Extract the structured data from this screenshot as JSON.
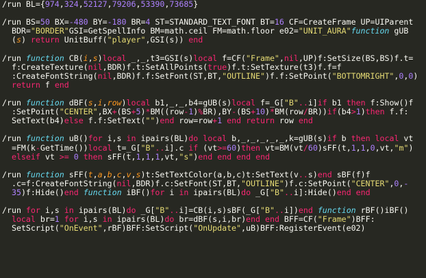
{
  "colors": {
    "background": "#272822",
    "default": "#F8F8F2",
    "keyword": "#F92672",
    "function_keyword": "#66D9EF",
    "string": "#E6DB74",
    "number": "#AE81FF",
    "parameter": "#FD971F"
  },
  "lines": [
    [
      [
        "id",
        "/run BL={"
      ],
      [
        "num",
        "974"
      ],
      [
        "id",
        ","
      ],
      [
        "num",
        "324"
      ],
      [
        "id",
        ","
      ],
      [
        "num",
        "52127"
      ],
      [
        "id",
        ","
      ],
      [
        "num",
        "79206"
      ],
      [
        "id",
        ","
      ],
      [
        "num",
        "53390"
      ],
      [
        "id",
        ","
      ],
      [
        "num",
        "73685"
      ],
      [
        "id",
        "}"
      ]
    ],
    [],
    [
      [
        "id",
        "/run BS="
      ],
      [
        "num",
        "50"
      ],
      [
        "id",
        " BX="
      ],
      [
        "num",
        "-480"
      ],
      [
        "id",
        " BY="
      ],
      [
        "num",
        "-180"
      ],
      [
        "id",
        " BR="
      ],
      [
        "num",
        "4"
      ],
      [
        "id",
        " ST=STANDARD_TEXT_FONT BT="
      ],
      [
        "num",
        "16"
      ],
      [
        "id",
        " CF=CreateFrame UP=UIParent"
      ]
    ],
    [
      [
        "id",
        "  BDR="
      ],
      [
        "str",
        "\"BORDER\""
      ],
      [
        "id",
        "GSI=GetSpellInfo BM=math.ceil FM=math.floor e02="
      ],
      [
        "str",
        "\"UNIT_AURA\""
      ],
      [
        "fn",
        "function"
      ],
      [
        "id",
        " gUB"
      ]
    ],
    [
      [
        "id",
        "  ("
      ],
      [
        "arg",
        "s"
      ],
      [
        "id",
        ") "
      ],
      [
        "kw",
        "return"
      ],
      [
        "id",
        " UnitBuff("
      ],
      [
        "str",
        "\"player\""
      ],
      [
        "id",
        ",GSI(s)) "
      ],
      [
        "kw",
        "end"
      ]
    ],
    [],
    [
      [
        "id",
        "/run "
      ],
      [
        "fn",
        "function"
      ],
      [
        "id",
        " CB("
      ],
      [
        "arg",
        "i"
      ],
      [
        "id",
        ","
      ],
      [
        "arg",
        "s"
      ],
      [
        "id",
        ")"
      ],
      [
        "kw",
        "local"
      ],
      [
        "id",
        " _,_,t3=GSI(s)"
      ],
      [
        "kw",
        "local"
      ],
      [
        "id",
        " f=CF("
      ],
      [
        "str",
        "\"Frame\""
      ],
      [
        "id",
        ","
      ],
      [
        "kw",
        "nil"
      ],
      [
        "id",
        ",UP)f:SetSize(BS,BS)f.t="
      ]
    ],
    [
      [
        "id",
        "  f:CreateTexture("
      ],
      [
        "kw",
        "nil"
      ],
      [
        "id",
        ",BDR)f.t:SetAllPoints("
      ],
      [
        "kw",
        "true"
      ],
      [
        "id",
        ")f.t:SetTexture(t3)f.f=f"
      ]
    ],
    [
      [
        "id",
        "  :CreateFontString("
      ],
      [
        "kw",
        "nil"
      ],
      [
        "id",
        ",BDR)f.f:SetFont(ST,BT,"
      ],
      [
        "str",
        "\"OUTLINE\""
      ],
      [
        "id",
        ")f.f:SetPoint("
      ],
      [
        "str",
        "\"BOTTOMRIGHT\""
      ],
      [
        "id",
        ","
      ],
      [
        "num",
        "0"
      ],
      [
        "id",
        ","
      ],
      [
        "num",
        "0"
      ],
      [
        "id",
        ")"
      ]
    ],
    [
      [
        "id",
        "  "
      ],
      [
        "kw",
        "return"
      ],
      [
        "id",
        " f "
      ],
      [
        "kw",
        "end"
      ]
    ],
    [],
    [
      [
        "id",
        "/run "
      ],
      [
        "fn",
        "function"
      ],
      [
        "id",
        " dBF("
      ],
      [
        "arg",
        "s"
      ],
      [
        "id",
        ","
      ],
      [
        "arg",
        "i"
      ],
      [
        "id",
        ","
      ],
      [
        "arg",
        "row"
      ],
      [
        "id",
        ")"
      ],
      [
        "kw",
        "local"
      ],
      [
        "id",
        " b1,_,_,b4=gUB(s)"
      ],
      [
        "kw",
        "local"
      ],
      [
        "id",
        " f=_G["
      ],
      [
        "str",
        "\"B\""
      ],
      [
        "kw",
        ".."
      ],
      [
        "id",
        "i]"
      ],
      [
        "kw",
        "if"
      ],
      [
        "id",
        " b1 "
      ],
      [
        "kw",
        "then"
      ],
      [
        "id",
        " f:Show()f"
      ]
    ],
    [
      [
        "id",
        "  :SetPoint("
      ],
      [
        "str",
        "\"CENTER\""
      ],
      [
        "id",
        ",BX"
      ],
      [
        "kw",
        "+"
      ],
      [
        "id",
        "(BS"
      ],
      [
        "kw",
        "+"
      ],
      [
        "num",
        "5"
      ],
      [
        "id",
        ")"
      ],
      [
        "kw",
        "*"
      ],
      [
        "id",
        "BM(("
      ],
      [
        "id",
        "row"
      ],
      [
        "kw",
        "-"
      ],
      [
        "num",
        "1"
      ],
      [
        "id",
        ")"
      ],
      [
        "kw",
        "%"
      ],
      [
        "id",
        "BR),BY"
      ],
      [
        "kw",
        "-"
      ],
      [
        "id",
        "(BS"
      ],
      [
        "kw",
        "+"
      ],
      [
        "num",
        "10"
      ],
      [
        "id",
        ")"
      ],
      [
        "kw",
        "*"
      ],
      [
        "id",
        "BM(row"
      ],
      [
        "kw",
        "/"
      ],
      [
        "id",
        "BR))"
      ],
      [
        "kw",
        "if"
      ],
      [
        "id",
        "(b4"
      ],
      [
        "kw",
        ">"
      ],
      [
        "num",
        "1"
      ],
      [
        "id",
        ")"
      ],
      [
        "kw",
        "then"
      ],
      [
        "id",
        " f.f:"
      ]
    ],
    [
      [
        "id",
        "  SetText(b4)"
      ],
      [
        "kw",
        "else"
      ],
      [
        "id",
        " f.f:SetText("
      ],
      [
        "str",
        "\"\""
      ],
      [
        "id",
        ")"
      ],
      [
        "kw",
        "end"
      ],
      [
        "id",
        " row=row"
      ],
      [
        "kw",
        "+"
      ],
      [
        "num",
        "1"
      ],
      [
        "id",
        " "
      ],
      [
        "kw",
        "end"
      ],
      [
        "id",
        " "
      ],
      [
        "kw",
        "return"
      ],
      [
        "id",
        " row "
      ],
      [
        "kw",
        "end"
      ]
    ],
    [],
    [
      [
        "id",
        "/run "
      ],
      [
        "fn",
        "function"
      ],
      [
        "id",
        " uB()"
      ],
      [
        "kw",
        "for"
      ],
      [
        "id",
        " i,s "
      ],
      [
        "kw",
        "in"
      ],
      [
        "id",
        " ipairs(BL)"
      ],
      [
        "kw",
        "do"
      ],
      [
        "id",
        " "
      ],
      [
        "kw",
        "local"
      ],
      [
        "id",
        " b,_,_,_,_,_,k=gUB(s)"
      ],
      [
        "kw",
        "if"
      ],
      [
        "id",
        " b "
      ],
      [
        "kw",
        "then"
      ],
      [
        "id",
        " "
      ],
      [
        "kw",
        "local"
      ],
      [
        "id",
        " vt"
      ]
    ],
    [
      [
        "id",
        "  =FM(k"
      ],
      [
        "kw",
        "-"
      ],
      [
        "id",
        "GetTime())"
      ],
      [
        "kw",
        "local"
      ],
      [
        "id",
        " t=_G["
      ],
      [
        "str",
        "\"B\""
      ],
      [
        "kw",
        ".."
      ],
      [
        "id",
        "i].c "
      ],
      [
        "kw",
        "if"
      ],
      [
        "id",
        " (vt"
      ],
      [
        "kw",
        ">="
      ],
      [
        "num",
        "60"
      ],
      [
        "id",
        ")"
      ],
      [
        "kw",
        "then"
      ],
      [
        "id",
        " vt=BM(vt"
      ],
      [
        "kw",
        "/"
      ],
      [
        "num",
        "60"
      ],
      [
        "id",
        ")sFF(t,"
      ],
      [
        "num",
        "1"
      ],
      [
        "id",
        ","
      ],
      [
        "num",
        "1"
      ],
      [
        "id",
        ","
      ],
      [
        "num",
        "0"
      ],
      [
        "id",
        ",vt,"
      ],
      [
        "str",
        "\"m\""
      ],
      [
        "id",
        ")"
      ]
    ],
    [
      [
        "id",
        "  "
      ],
      [
        "kw",
        "elseif"
      ],
      [
        "id",
        " vt "
      ],
      [
        "kw",
        ">="
      ],
      [
        "id",
        " "
      ],
      [
        "num",
        "0"
      ],
      [
        "id",
        " "
      ],
      [
        "kw",
        "then"
      ],
      [
        "id",
        " sFF(t,"
      ],
      [
        "num",
        "1"
      ],
      [
        "id",
        ","
      ],
      [
        "num",
        "1"
      ],
      [
        "id",
        ","
      ],
      [
        "num",
        "1"
      ],
      [
        "id",
        ",vt,"
      ],
      [
        "str",
        "\"s\""
      ],
      [
        "id",
        ")"
      ],
      [
        "kw",
        "end"
      ],
      [
        "id",
        " "
      ],
      [
        "kw",
        "end"
      ],
      [
        "id",
        " "
      ],
      [
        "kw",
        "end"
      ],
      [
        "id",
        " "
      ],
      [
        "kw",
        "end"
      ]
    ],
    [],
    [
      [
        "id",
        "/run "
      ],
      [
        "fn",
        "function"
      ],
      [
        "id",
        " sFF("
      ],
      [
        "arg",
        "t"
      ],
      [
        "id",
        ","
      ],
      [
        "arg",
        "a"
      ],
      [
        "id",
        ","
      ],
      [
        "arg",
        "b"
      ],
      [
        "id",
        ","
      ],
      [
        "arg",
        "c"
      ],
      [
        "id",
        ","
      ],
      [
        "arg",
        "v"
      ],
      [
        "id",
        ","
      ],
      [
        "arg",
        "s"
      ],
      [
        "id",
        ")t:SetTextColor(a,b,c)t:SetText(v"
      ],
      [
        "kw",
        ".."
      ],
      [
        "id",
        "s)"
      ],
      [
        "kw",
        "end"
      ],
      [
        "id",
        " sBF(f)f"
      ]
    ],
    [
      [
        "id",
        "  .c=f:CreateFontString("
      ],
      [
        "kw",
        "nil"
      ],
      [
        "id",
        ",BDR)f.c:SetFont(ST,BT,"
      ],
      [
        "str",
        "\"OUTLINE\""
      ],
      [
        "id",
        ")f.c:SetPoint("
      ],
      [
        "str",
        "\"CENTER\""
      ],
      [
        "id",
        ","
      ],
      [
        "num",
        "0"
      ],
      [
        "id",
        ","
      ],
      [
        "num",
        "-"
      ]
    ],
    [
      [
        "id",
        "  "
      ],
      [
        "num",
        "35"
      ],
      [
        "id",
        ")f:Hide()"
      ],
      [
        "kw",
        "end"
      ],
      [
        "id",
        " "
      ],
      [
        "fn",
        "function"
      ],
      [
        "id",
        " iBF()"
      ],
      [
        "kw",
        "for"
      ],
      [
        "id",
        " i "
      ],
      [
        "kw",
        "in"
      ],
      [
        "id",
        " ipairs(BL)"
      ],
      [
        "kw",
        "do"
      ],
      [
        "id",
        " _G["
      ],
      [
        "str",
        "\"B\""
      ],
      [
        "kw",
        ".."
      ],
      [
        "id",
        "i]:Hide()"
      ],
      [
        "kw",
        "end"
      ],
      [
        "id",
        " "
      ],
      [
        "kw",
        "end"
      ]
    ],
    [],
    [
      [
        "id",
        "/run "
      ],
      [
        "kw",
        "for"
      ],
      [
        "id",
        " i,s "
      ],
      [
        "kw",
        "in"
      ],
      [
        "id",
        " ipairs(BL)"
      ],
      [
        "kw",
        "do"
      ],
      [
        "id",
        " _G["
      ],
      [
        "str",
        "\"B\""
      ],
      [
        "kw",
        ".."
      ],
      [
        "id",
        "i]=CB(i,s)sBF(_G["
      ],
      [
        "str",
        "\"B\""
      ],
      [
        "kw",
        ".."
      ],
      [
        "id",
        "i])"
      ],
      [
        "kw",
        "end"
      ],
      [
        "id",
        " "
      ],
      [
        "fn",
        "function"
      ],
      [
        "id",
        " rBF()iBF()"
      ]
    ],
    [
      [
        "id",
        "  "
      ],
      [
        "kw",
        "local"
      ],
      [
        "id",
        " br="
      ],
      [
        "num",
        "1"
      ],
      [
        "id",
        " "
      ],
      [
        "kw",
        "for"
      ],
      [
        "id",
        " i,s "
      ],
      [
        "kw",
        "in"
      ],
      [
        "id",
        " ipairs(BL)"
      ],
      [
        "kw",
        "do"
      ],
      [
        "id",
        " br=dBF(s,i,br)"
      ],
      [
        "kw",
        "end"
      ],
      [
        "id",
        " "
      ],
      [
        "kw",
        "end"
      ],
      [
        "id",
        " BFF=CF("
      ],
      [
        "str",
        "\"Frame\""
      ],
      [
        "id",
        ")BFF:"
      ]
    ],
    [
      [
        "id",
        "  SetScript("
      ],
      [
        "str",
        "\"OnEvent\""
      ],
      [
        "id",
        ",rBF)BFF:SetScript("
      ],
      [
        "str",
        "\"OnUpdate\""
      ],
      [
        "id",
        ",uB)BFF:RegisterEvent(e02)"
      ]
    ]
  ]
}
